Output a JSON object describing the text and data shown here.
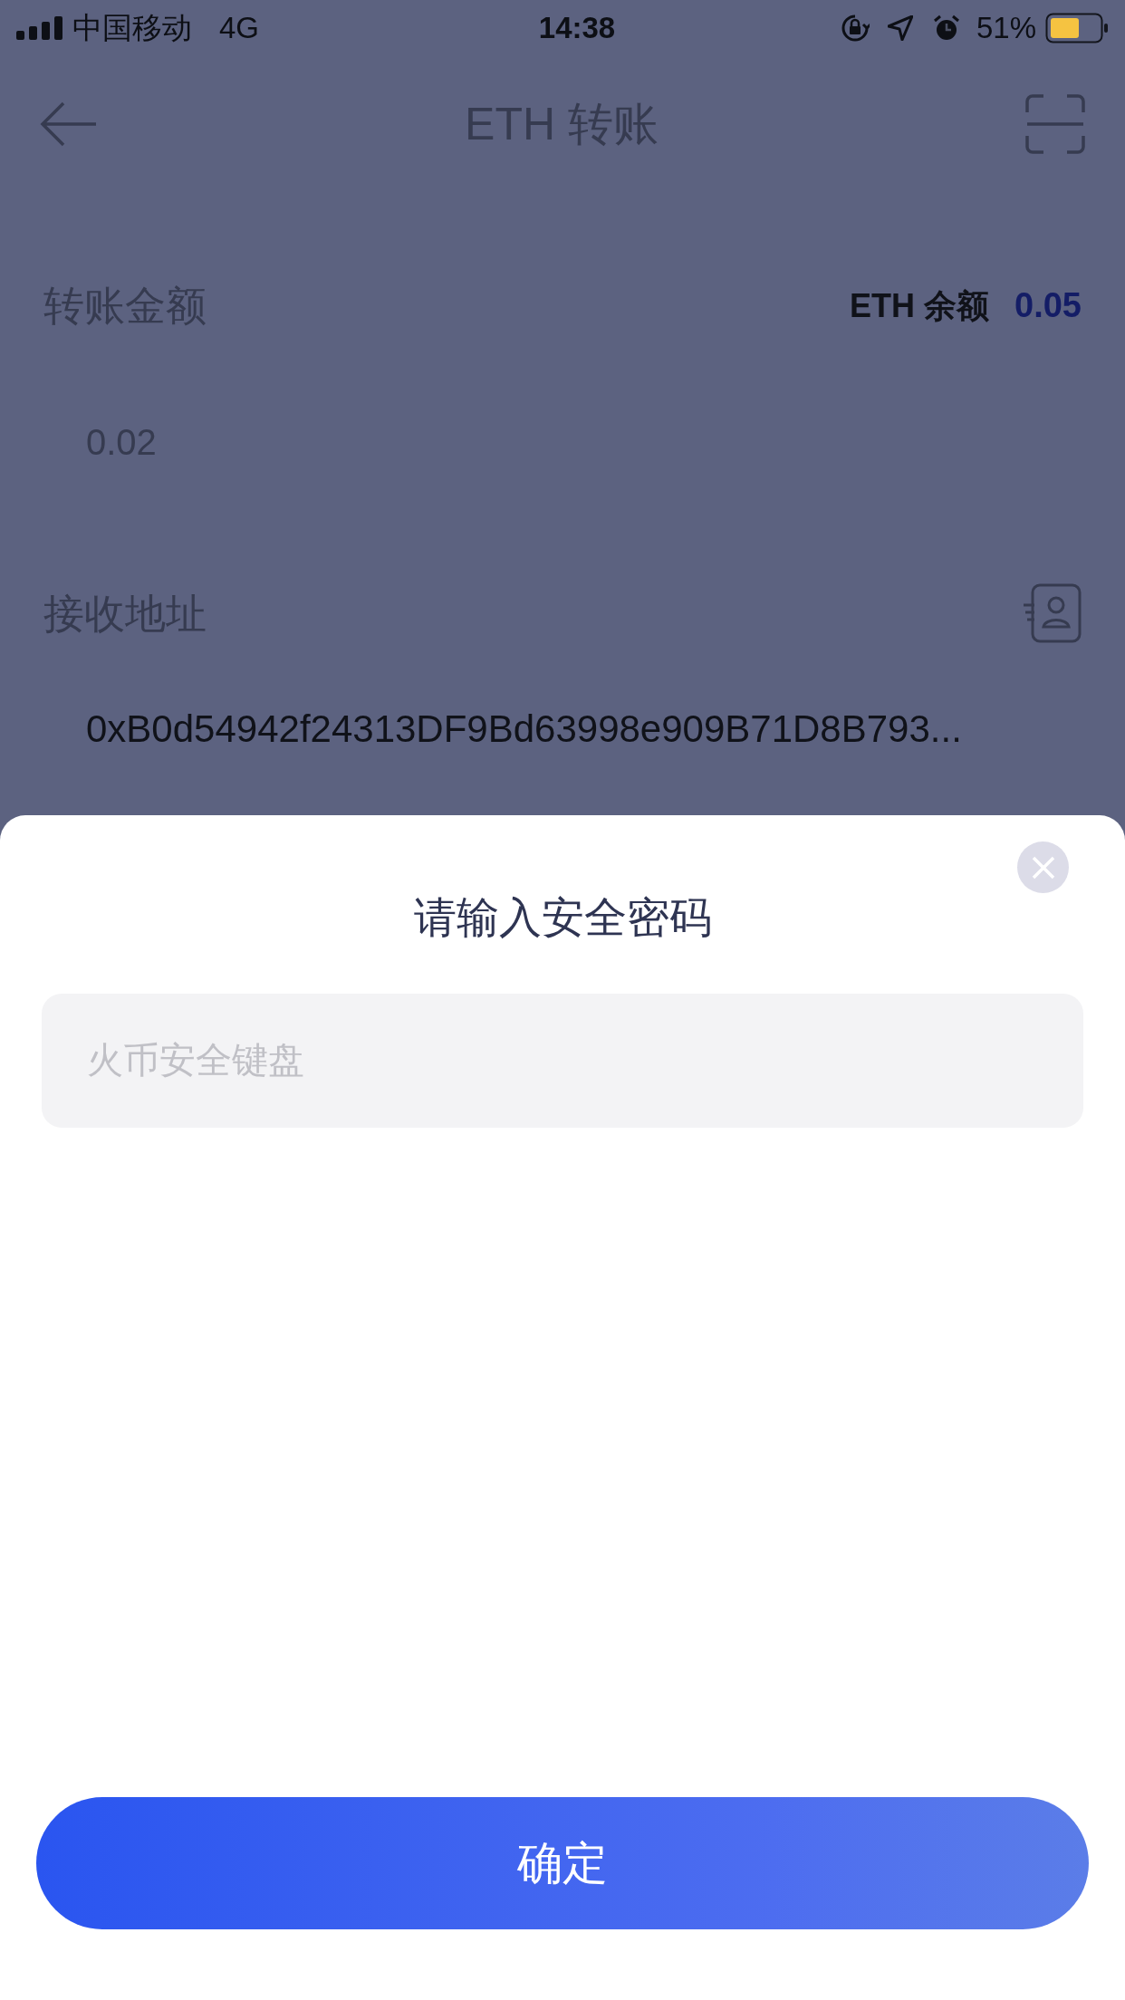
{
  "status_bar": {
    "carrier": "中国移动",
    "network": "4G",
    "time": "14:38",
    "battery_percent": "51%"
  },
  "nav": {
    "title": "ETH 转账"
  },
  "amount": {
    "label": "转账金额",
    "balance_label": "ETH 余额",
    "balance_value": "0.05",
    "value": "0.02"
  },
  "address": {
    "label": "接收地址",
    "value": "0xB0d54942f24313DF9Bd63998e909B71D8B793..."
  },
  "sheet": {
    "title": "请输入安全密码",
    "input_placeholder": "火币安全键盘",
    "confirm_button": "确定"
  }
}
